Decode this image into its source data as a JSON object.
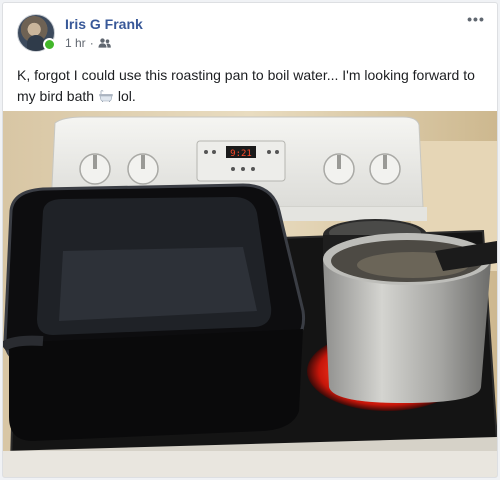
{
  "post": {
    "author": "Iris G Frank",
    "time": "1 hr",
    "separator": "·",
    "audience_icon": "friends-icon",
    "more_label": "•••",
    "text_main": "K, forgot I could use this roasting pan to boil water... I'm looking forward to my bird bath",
    "text_emoji_icon": "bathtub-icon",
    "text_after": "lol.",
    "online_color": "#42b72a",
    "name_color": "#385898"
  },
  "photo": {
    "stove_display": "9:21"
  }
}
